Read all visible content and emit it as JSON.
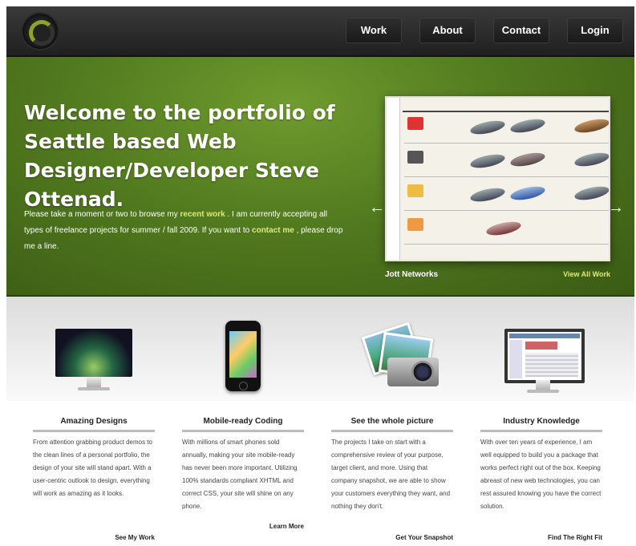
{
  "nav": [
    "Work",
    "About",
    "Contact",
    "Login"
  ],
  "hero": {
    "title": "Welcome to the portfolio of Seattle based Web Designer/Developer Steve Ottenad.",
    "text_1": "Please take a moment or two to browse my ",
    "link_1": "recent work",
    "text_2": " . I am currently accepting all types of freelance projects for summer / fall 2009. If you want to ",
    "link_2": "contact me",
    "text_3": " , please drop me a line."
  },
  "slideshow": {
    "caption": "Jott Networks",
    "view_all": "View All Work",
    "prev_icon": "arrow-left-icon",
    "next_icon": "arrow-right-icon"
  },
  "features": [
    {
      "title": "Amazing Designs",
      "body": "From attention grabbing product demos to the clean lines of a personal portfolio, the design of your site will stand apart. With a user-centric outlook to design, everything will work as amazing as it looks.",
      "link": "See My Work",
      "icon": "imac-icon"
    },
    {
      "title": "Mobile-ready Coding",
      "body": "With millions of smart phones sold annually, making your site mobile-ready has never been more important. Utilizing 100% standards compliant XHTML and correct CSS, your site will shine on any phone.",
      "link": "Learn More",
      "icon": "iphone-icon"
    },
    {
      "title": "See the whole picture",
      "body": "The projects I take on start with a comprehensive review of your purpose, target client, and more. Using that company snapshot, we are able to show your customers everything they want, and nothing they don't.",
      "link": "Get Your Snapshot",
      "icon": "camera-icon"
    },
    {
      "title": "Industry Knowledge",
      "body": "With over ten years of experience, I am well equipped to build you a package that works perfect right out of the box. Keeping abreast of new web technologies, you can rest assured knowing you have the correct solution.",
      "link": "Find The Right Fit",
      "icon": "monitor-icon"
    }
  ],
  "colors": {
    "accent": "#dfe87a",
    "hero_green": "#527a1f",
    "logo_green": "#8aa52a"
  }
}
